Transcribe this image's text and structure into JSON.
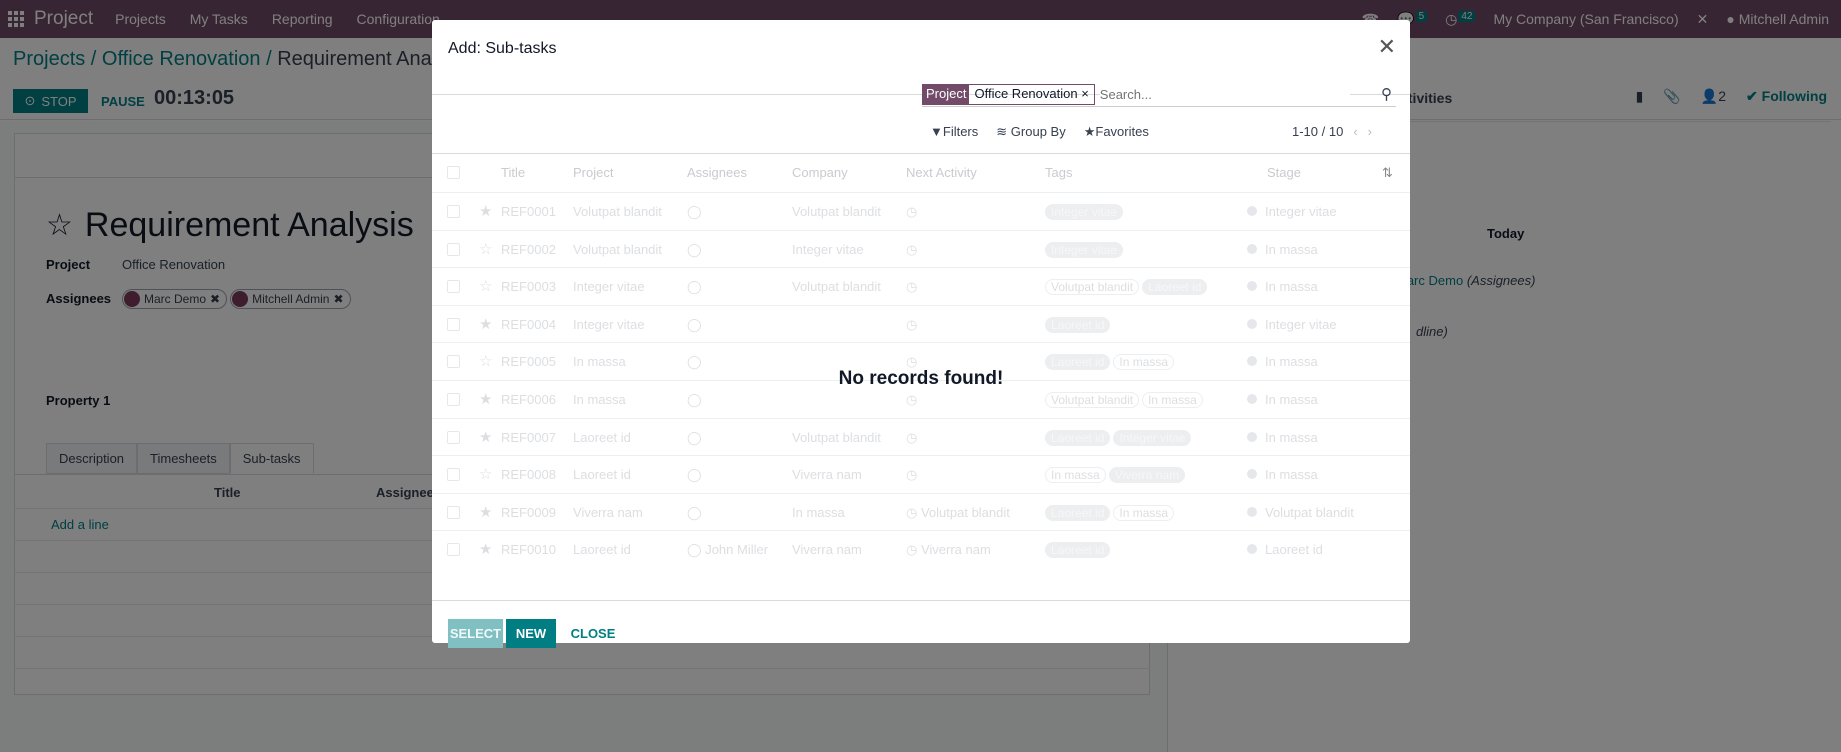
{
  "navbar": {
    "app": "Project",
    "menus": [
      "Projects",
      "My Tasks",
      "Reporting",
      "Configuration"
    ],
    "chat_count": "5",
    "activity_count": "42",
    "company": "My Company (San Francisco)",
    "user": "Mitchell Admin"
  },
  "breadcrumb": {
    "root": "Projects",
    "project": "Office Renovation",
    "current": "Requirement Analysis"
  },
  "timer": {
    "stop": "STOP",
    "pause": "PAUSE",
    "time": "00:13:05"
  },
  "chatter": {
    "activities": "Activities",
    "followers": "2",
    "following": "Following",
    "today": "Today",
    "author": "Marc Demo",
    "author_note": "(Assignees)",
    "note2": "dline)"
  },
  "form": {
    "title": "Requirement Analysis",
    "project_label": "Project",
    "project_value": "Office Renovation",
    "assignees_label": "Assignees",
    "assignees": [
      "Marc Demo",
      "Mitchell Admin"
    ],
    "property_label": "Property 1",
    "tabs": [
      "Description",
      "Timesheets",
      "Sub-tasks"
    ],
    "col_title": "Title",
    "col_assignees": "Assignees",
    "add_line": "Add a line"
  },
  "modal": {
    "title": "Add: Sub-tasks",
    "facet_key": "Project",
    "facet_value": "Office Renovation",
    "search_placeholder": "Search...",
    "filters": "Filters",
    "group_by": "Group By",
    "favorites": "Favorites",
    "pager": "1-10 / 10",
    "columns": [
      "Title",
      "Project",
      "Assignees",
      "Company",
      "Next Activity",
      "Tags",
      "Stage"
    ],
    "rows": [
      {
        "ref": "REF0001",
        "project": "Volutpat blandit",
        "assignee": "",
        "company": "Volutpat blandit",
        "activity": "",
        "tags": [
          [
            "Integer vitae",
            1
          ]
        ],
        "stage": "Integer vitae",
        "starred": true
      },
      {
        "ref": "REF0002",
        "project": "Volutpat blandit",
        "assignee": "",
        "company": "Integer vitae",
        "activity": "",
        "tags": [
          [
            "Integer vitae",
            1
          ]
        ],
        "stage": "In massa",
        "starred": false
      },
      {
        "ref": "REF0003",
        "project": "Integer vitae",
        "assignee": "",
        "company": "Volutpat blandit",
        "activity": "",
        "tags": [
          [
            "Volutpat blandit",
            0
          ],
          [
            "Laoreet id",
            1
          ]
        ],
        "stage": "In massa",
        "starred": false
      },
      {
        "ref": "REF0004",
        "project": "Integer vitae",
        "assignee": "",
        "company": "",
        "activity": "",
        "tags": [
          [
            "Laoreet id",
            1
          ]
        ],
        "stage": "Integer vitae",
        "starred": true
      },
      {
        "ref": "REF0005",
        "project": "In massa",
        "assignee": "",
        "company": "",
        "activity": "",
        "tags": [
          [
            "Laoreet id",
            1
          ],
          [
            "In massa",
            0
          ]
        ],
        "stage": "In massa",
        "starred": false
      },
      {
        "ref": "REF0006",
        "project": "In massa",
        "assignee": "",
        "company": "",
        "activity": "",
        "tags": [
          [
            "Volutpat blandit",
            0
          ],
          [
            "In massa",
            0
          ]
        ],
        "stage": "In massa",
        "starred": true
      },
      {
        "ref": "REF0007",
        "project": "Laoreet id",
        "assignee": "",
        "company": "Volutpat blandit",
        "activity": "",
        "tags": [
          [
            "Laoreet id",
            1
          ],
          [
            "Integer vitae",
            1
          ]
        ],
        "stage": "In massa",
        "starred": true
      },
      {
        "ref": "REF0008",
        "project": "Laoreet id",
        "assignee": "",
        "company": "Viverra nam",
        "activity": "",
        "tags": [
          [
            "In massa",
            0
          ],
          [
            "Viverra nam",
            1
          ]
        ],
        "stage": "In massa",
        "starred": false
      },
      {
        "ref": "REF0009",
        "project": "Viverra nam",
        "assignee": "",
        "company": "In massa",
        "activity": "Volutpat blandit",
        "tags": [
          [
            "Laoreet id",
            1
          ],
          [
            "In massa",
            0
          ]
        ],
        "stage": "Volutpat blandit",
        "starred": true
      },
      {
        "ref": "REF0010",
        "project": "Laoreet id",
        "assignee": "John Miller",
        "company": "Viverra nam",
        "activity": "Viverra nam",
        "tags": [
          [
            "Laoreet id",
            1
          ]
        ],
        "stage": "Laoreet id",
        "starred": true
      }
    ],
    "empty": "No records found!",
    "select": "SELECT",
    "new": "NEW",
    "close": "CLOSE"
  },
  "colors": {
    "brand": "#714b67",
    "accent": "#017e84",
    "select_disabled": "#80c0c3"
  }
}
